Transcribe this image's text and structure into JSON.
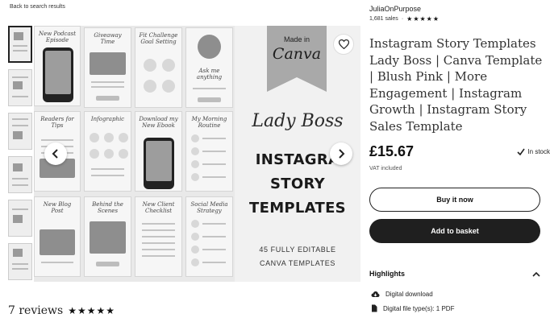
{
  "back_link": "Back to search results",
  "gallery": {
    "tiles": [
      {
        "title": "New Podcast Episode"
      },
      {
        "title": "Giveaway Time"
      },
      {
        "title": "Fit Challenge Goal Setting"
      },
      {
        "title": "Ask me anything"
      },
      {
        "title": "Readers for Tips"
      },
      {
        "title": "Infographic"
      },
      {
        "title": "Download my New Ebook"
      },
      {
        "title": "My Morning Routine"
      },
      {
        "title": "New Blog Post"
      },
      {
        "title": "Behind the Scenes"
      },
      {
        "title": "New Client Checklist"
      },
      {
        "title": "Social Media Strategy"
      }
    ],
    "brand": {
      "made_in": "Made in",
      "canva": "Canva",
      "script": "Lady Boss",
      "line1": "INSTAGRA",
      "line2": "STORY",
      "line3": "TEMPLATES",
      "sub1": "45 FULLY EDITABLE",
      "sub2": "CANVA TEMPLATES"
    },
    "icons": {
      "favorite": "heart-icon",
      "prev": "chevron-left-icon",
      "next": "chevron-right-icon"
    }
  },
  "reviews": {
    "label": "7 reviews",
    "stars": "★★★★★",
    "rating": 5
  },
  "listing": {
    "shop_name": "JuliaOnPurpose",
    "sales": "1,681 sales",
    "shop_stars": "★★★★★",
    "title": "Instagram Story Templates Lady Boss | Canva Template | Blush Pink | More Engagement | Instagram Growth | Instagram Story Sales Template",
    "price": "£15.67",
    "stock": "In stock",
    "vat": "VAT included",
    "buy_now": "Buy it now",
    "add_to_basket": "Add to basket",
    "highlights_title": "Highlights",
    "highlights": [
      {
        "icon": "cloud-download-icon",
        "text": "Digital download"
      },
      {
        "icon": "file-icon",
        "text": "Digital file type(s): 1 PDF"
      }
    ]
  }
}
